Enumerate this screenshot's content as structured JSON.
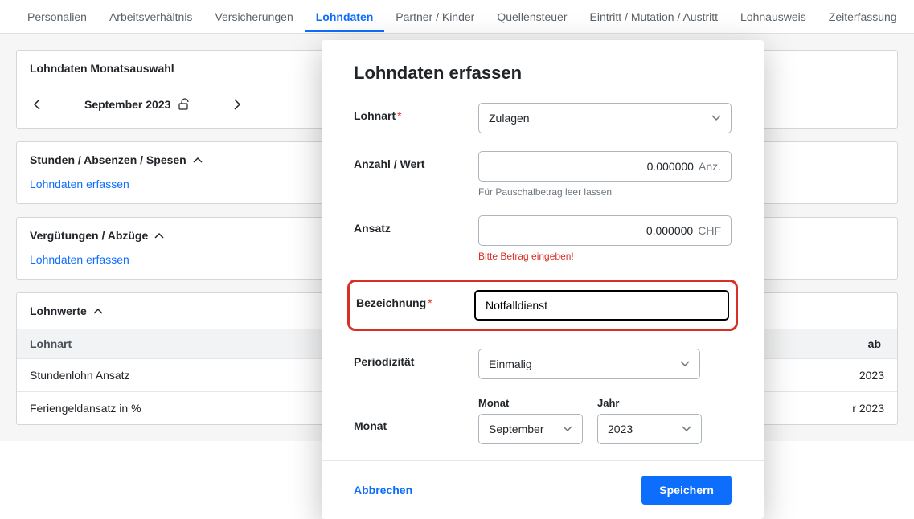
{
  "tabs": {
    "personalien": "Personalien",
    "arbeitsverhaeltnis": "Arbeitsverhältnis",
    "versicherungen": "Versicherungen",
    "lohndaten": "Lohndaten",
    "partner_kinder": "Partner / Kinder",
    "quellensteuer": "Quellensteuer",
    "eintritt_mutation_austritt": "Eintritt / Mutation / Austritt",
    "lohnausweis": "Lohnausweis",
    "zeiterfassung": "Zeiterfassung"
  },
  "monthPanel": {
    "title": "Lohndaten Monatsauswahl",
    "current": "September 2023"
  },
  "section1": {
    "title": "Stunden / Absenzen / Spesen",
    "link": "Lohndaten erfassen"
  },
  "section2": {
    "title": "Vergütungen / Abzüge",
    "link": "Lohndaten erfassen"
  },
  "lohnwerte": {
    "title": "Lohnwerte",
    "col1": "Lohnart",
    "col_right": "ab",
    "rows": {
      "r1": {
        "name": "Stundenlohn Ansatz",
        "right": "2023"
      },
      "r2": {
        "name": "Feriengeldansatz in %",
        "right": "r 2023"
      }
    }
  },
  "modal": {
    "title": "Lohndaten erfassen",
    "lohnart_label": "Lohnart",
    "lohnart_value": "Zulagen",
    "anzahl_label": "Anzahl / Wert",
    "anzahl_value": "0.000000",
    "anzahl_unit": "Anz.",
    "anzahl_hint": "Für Pauschalbetrag leer lassen",
    "ansatz_label": "Ansatz",
    "ansatz_value": "0.000000",
    "ansatz_unit": "CHF",
    "ansatz_hint": "Bitte Betrag eingeben!",
    "bezeichnung_label": "Bezeichnung",
    "bezeichnung_value": "Notfalldienst",
    "periodizitaet_label": "Periodizität",
    "periodizitaet_value": "Einmalig",
    "monat_label": "Monat",
    "monat_sub_month": "Monat",
    "monat_sub_year": "Jahr",
    "monat_value": "September",
    "jahr_value": "2023",
    "cancel": "Abbrechen",
    "save": "Speichern"
  }
}
